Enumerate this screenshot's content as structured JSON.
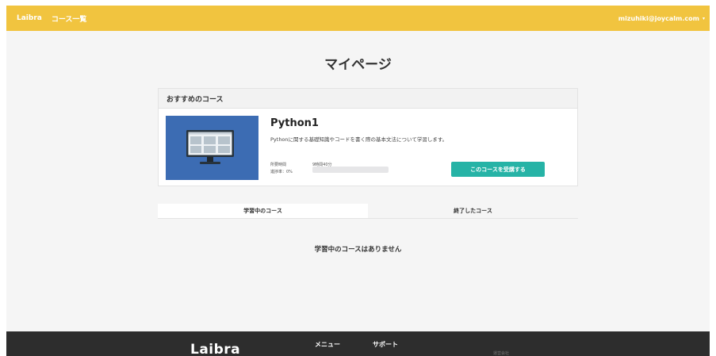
{
  "header": {
    "brand": "Laibra",
    "nav": {
      "courses_label": "コース一覧"
    },
    "user": {
      "email": "mizuhiki@joycalm.com",
      "caret": "▾"
    }
  },
  "page": {
    "title": "マイページ"
  },
  "recommended": {
    "heading": "おすすめのコース",
    "course": {
      "title": "Python1",
      "description": "Pythonに関する基礎知識やコードを書く際の基本文法について学習します。",
      "time_label": "所要時間",
      "time_value": "9時間40分",
      "progress_label": "進捗率：0%",
      "progress_value": 0,
      "enroll_label": "このコースを受講する"
    }
  },
  "tabs": [
    {
      "label": "学習中のコース",
      "active": true
    },
    {
      "label": "終了したコース",
      "active": false
    }
  ],
  "empty_message": "学習中のコースはありません",
  "footer": {
    "logo": "Laibra",
    "menu_label": "メニュー",
    "support_label": "サポート",
    "company_label": "運営会社"
  },
  "colors": {
    "header_bg": "#f1c43f",
    "accent": "#26b3a6",
    "thumb_bg": "#3c6cb3",
    "footer_bg": "#2d2d2d"
  }
}
